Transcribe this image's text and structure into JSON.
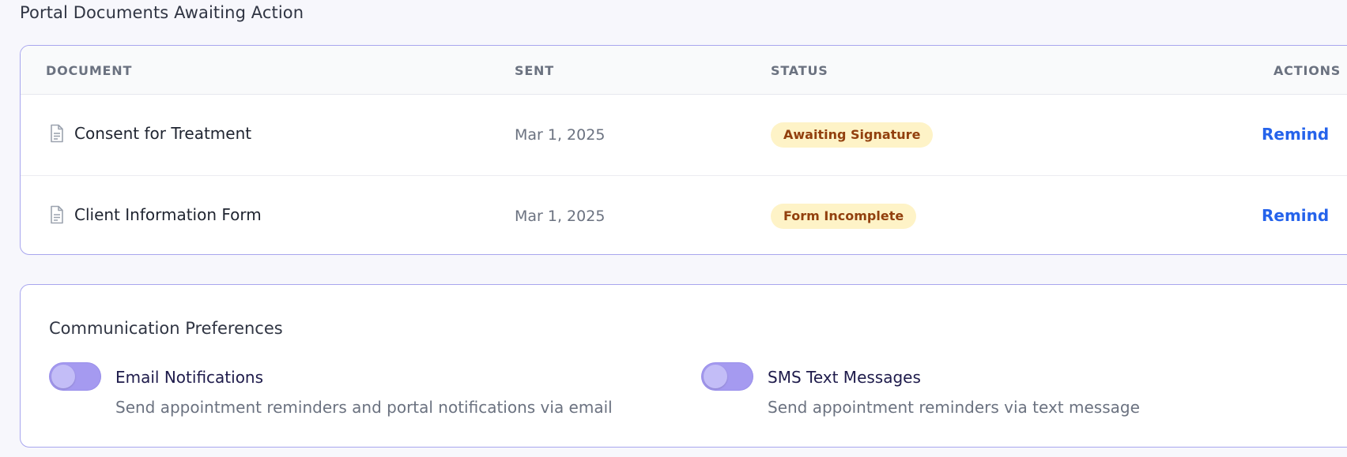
{
  "portal": {
    "title": "Portal Documents Awaiting Action",
    "columns": {
      "document": "DOCUMENT",
      "sent": "SENT",
      "status": "STATUS",
      "actions": "ACTIONS"
    },
    "rows": [
      {
        "icon": "document-icon",
        "name": "Consent for Treatment",
        "sent": "Mar 1, 2025",
        "status": "Awaiting Signature",
        "action": "Remind"
      },
      {
        "icon": "document-icon",
        "name": "Client Information Form",
        "sent": "Mar 1, 2025",
        "status": "Form Incomplete",
        "action": "Remind"
      }
    ]
  },
  "preferences": {
    "title": "Communication Preferences",
    "items": [
      {
        "label": "Email Notifications",
        "description": "Send appointment reminders and portal notifications via email",
        "enabled": false
      },
      {
        "label": "SMS Text Messages",
        "description": "Send appointment reminders via text message",
        "enabled": false
      }
    ]
  },
  "colors": {
    "accent": "#a59af0",
    "link": "#2563eb",
    "badge_bg": "#fef3c7",
    "badge_text": "#92400e",
    "card_border": "#a8a6ee"
  }
}
